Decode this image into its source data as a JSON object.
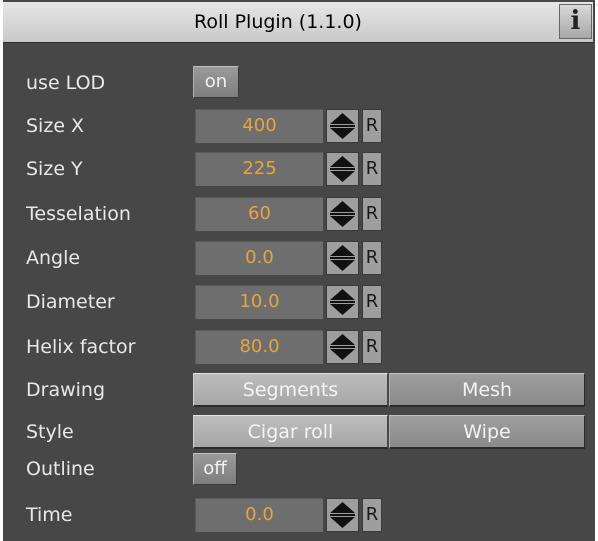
{
  "header": {
    "title": "Roll Plugin (1.1.0)",
    "info_glyph": "i"
  },
  "params": {
    "use_lod": {
      "label": "use LOD",
      "value": "on"
    },
    "size_x": {
      "label": "Size X",
      "value": "400",
      "reset": "R"
    },
    "size_y": {
      "label": "Size Y",
      "value": "225",
      "reset": "R"
    },
    "tesselation": {
      "label": "Tesselation",
      "value": "60",
      "reset": "R"
    },
    "angle": {
      "label": "Angle",
      "value": "0.0",
      "reset": "R"
    },
    "diameter": {
      "label": "Diameter",
      "value": "10.0",
      "reset": "R"
    },
    "helix_factor": {
      "label": "Helix factor",
      "value": "80.0",
      "reset": "R"
    },
    "drawing": {
      "label": "Drawing",
      "options": [
        "Segments",
        "Mesh"
      ],
      "selected": "Segments"
    },
    "style": {
      "label": "Style",
      "options": [
        "Cigar roll",
        "Wipe"
      ],
      "selected": "Cigar roll"
    },
    "outline": {
      "label": "Outline",
      "value": "off"
    },
    "time": {
      "label": "Time",
      "value": "0.0",
      "reset": "R"
    }
  },
  "colors": {
    "panel_bg": "#474747",
    "value_text": "#e8a43e",
    "label_text": "#e8e8e8"
  },
  "icons": {
    "info": "info-icon",
    "spinner": "spinner-up-down-icon"
  }
}
